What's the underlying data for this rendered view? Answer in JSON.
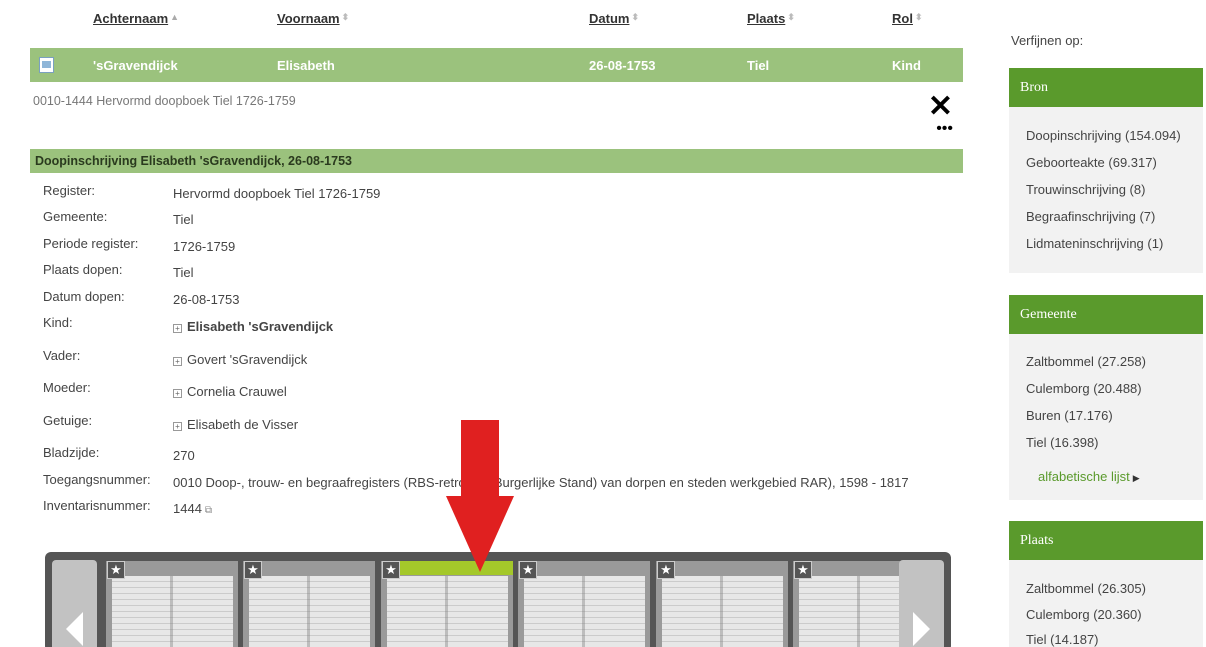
{
  "table": {
    "headers": [
      "Achternaam",
      "Voornaam",
      "Datum",
      "Plaats",
      "Rol"
    ],
    "selected_row": {
      "achternaam": "'sGravendijck",
      "voornaam": "Elisabeth",
      "datum": "26-08-1753",
      "plaats": "Tiel",
      "rol": "Kind"
    }
  },
  "detail": {
    "source": "0010-1444 Hervormd doopboek Tiel 1726-1759",
    "close_label": "✕",
    "more_label": "•••",
    "title": "Doopinschrijving Elisabeth 'sGravendijck, 26-08-1753",
    "fields": [
      {
        "label": "Register:",
        "value": "Hervormd doopboek Tiel 1726-1759"
      },
      {
        "label": "Gemeente:",
        "value": "Tiel"
      },
      {
        "label": "Periode register:",
        "value": "1726-1759"
      },
      {
        "label": "Plaats dopen:",
        "value": "Tiel"
      },
      {
        "label": "Datum dopen:",
        "value": "26-08-1753"
      },
      {
        "label": "Kind:",
        "value": "Elisabeth 'sGravendijck"
      },
      {
        "label": "Vader:",
        "value": "Govert 'sGravendijck"
      },
      {
        "label": "Moeder:",
        "value": "Cornelia Crauwel"
      },
      {
        "label": "Getuige:",
        "value": "Elisabeth de Visser"
      },
      {
        "label": "Bladzijde:",
        "value": "270"
      },
      {
        "label": "Toegangsnummer:",
        "value": "0010 Doop-, trouw- en begraafregisters (RBS-retroacta Burgerlijke Stand) van dorpen en steden werkgebied RAR), 1598 - 1817"
      },
      {
        "label": "Inventarisnummer:",
        "value": "1444"
      }
    ]
  },
  "viewer": {
    "active_thumbnail_index": 2,
    "thumbnail_count": 6
  },
  "sidebar": {
    "title": "Verfijnen op:",
    "panels": [
      {
        "title": "Bron",
        "items": [
          "Doopinschrijving (154.094)",
          "Geboorteakte (69.317)",
          "Trouwinschrijving (8)",
          "Begraafinschrijving (7)",
          "Lidmateninschrijving (1)"
        ]
      },
      {
        "title": "Gemeente",
        "items": [
          "Zaltbommel (27.258)",
          "Culemborg (20.488)",
          "Buren (17.176)",
          "Tiel (16.398)"
        ],
        "link": "alfabetische lijst"
      },
      {
        "title": "Plaats",
        "items": [
          "Zaltbommel (26.305)",
          "Culemborg (20.360)",
          "Tiel (14.187)"
        ]
      }
    ]
  },
  "colors": {
    "row_green": "#9bc27d",
    "panel_green": "#5a9a2c",
    "highlight": "#a4c82a",
    "arrow_red": "#e02020"
  }
}
